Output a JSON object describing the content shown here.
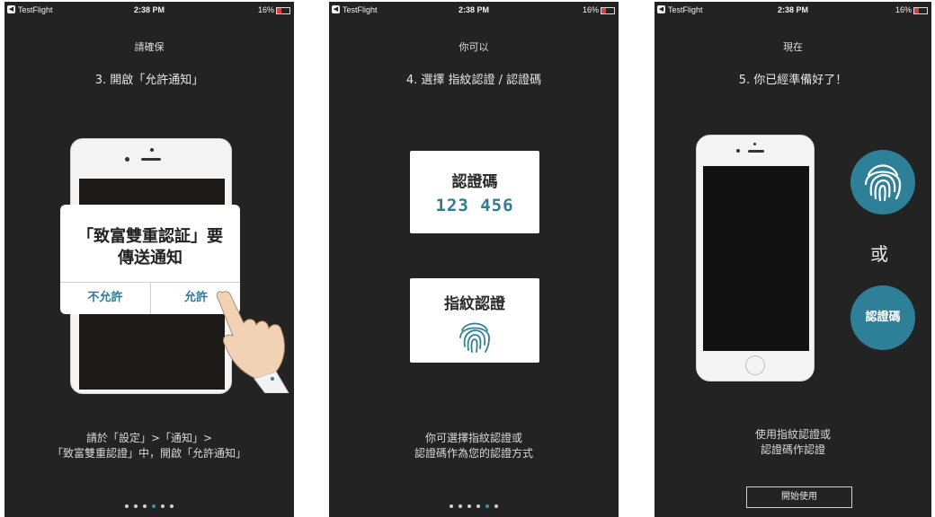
{
  "status": {
    "app": "TestFlight",
    "time": "2:38 PM",
    "battery": "16%",
    "back_glyph": "◀"
  },
  "screen1": {
    "kicker": "請確保",
    "step": "3. 開啟「允許通知」",
    "alert_title_line1": "「致富雙重認証」要",
    "alert_title_line2": "傳送通知",
    "deny": "不允許",
    "allow": "允許",
    "caption_line1": "請於「設定」>「通知」>",
    "caption_line2": "「致富雙重認證」中，開啟「允許通知」",
    "active_dot": 3,
    "dot_count": 6
  },
  "screen2": {
    "kicker": "你可以",
    "step": "4. 選擇 指紋認證 / 認證碼",
    "code_title": "認證碼",
    "code_value": "123 456",
    "fp_title": "指紋認證",
    "caption_line1": "你可選擇指紋認證或",
    "caption_line2": "認證碼作為您的認證方式",
    "active_dot": 4,
    "dot_count": 6
  },
  "screen3": {
    "kicker": "現在",
    "step": "5. 你已經準備好了！",
    "or": "或",
    "code_circle": "認證碼",
    "caption_line1": "使用指紋認證或",
    "caption_line2": "認證碼作認證",
    "start_button": "開始使用"
  },
  "colors": {
    "background": "#232323",
    "accent": "#2e7f98",
    "active_dot": "#3b8fb0"
  }
}
